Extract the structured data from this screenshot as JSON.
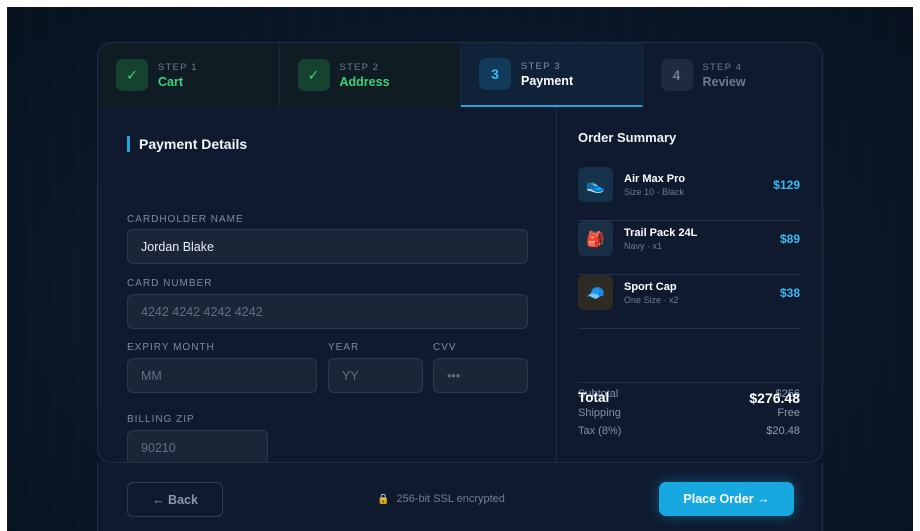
{
  "stepper": {
    "steps": [
      {
        "num": "STEP 1",
        "label": "Cart",
        "badge": "✓"
      },
      {
        "num": "STEP 2",
        "label": "Address",
        "badge": "✓"
      },
      {
        "num": "STEP 3",
        "label": "Payment",
        "badge": "3"
      },
      {
        "num": "STEP 4",
        "label": "Review",
        "badge": "4"
      }
    ]
  },
  "form": {
    "title": "Payment Details",
    "cardholder": {
      "label": "CARDHOLDER NAME",
      "value": "Jordan Blake"
    },
    "card_number": {
      "label": "CARD NUMBER",
      "placeholder": "4242 4242 4242 4242"
    },
    "expiry_month": {
      "label": "EXPIRY MONTH",
      "placeholder": "MM"
    },
    "year": {
      "label": "YEAR",
      "placeholder": "YY"
    },
    "cvv": {
      "label": "CVV",
      "placeholder": "•••"
    },
    "zip": {
      "label": "BILLING ZIP",
      "placeholder": "90210"
    }
  },
  "summary": {
    "title": "Order Summary",
    "items": [
      {
        "icon": "👟",
        "name": "Air Max Pro",
        "meta": "Size 10 · Black",
        "price": "$129"
      },
      {
        "icon": "🎒",
        "name": "Trail Pack 24L",
        "meta": "Navy · x1",
        "price": "$89"
      },
      {
        "icon": "🧢",
        "name": "Sport Cap",
        "meta": "One Size · x2",
        "price": "$38"
      }
    ],
    "subtotal": {
      "label": "Subtotal",
      "value": "$256"
    },
    "shipping": {
      "label": "Shipping",
      "value": "Free"
    },
    "tax": {
      "label": "Tax (8%)",
      "value": "$20.48"
    },
    "total": {
      "label": "Total",
      "value": "$276.48"
    }
  },
  "footer": {
    "back_label": "← Back",
    "ssl_icon": "🔒",
    "ssl_text": "256-bit SSL encrypted",
    "place_label": "Place Order →"
  },
  "colors": {
    "accent": "#18a8e0",
    "success": "#3dd17a",
    "background": "#0f1a2e"
  }
}
